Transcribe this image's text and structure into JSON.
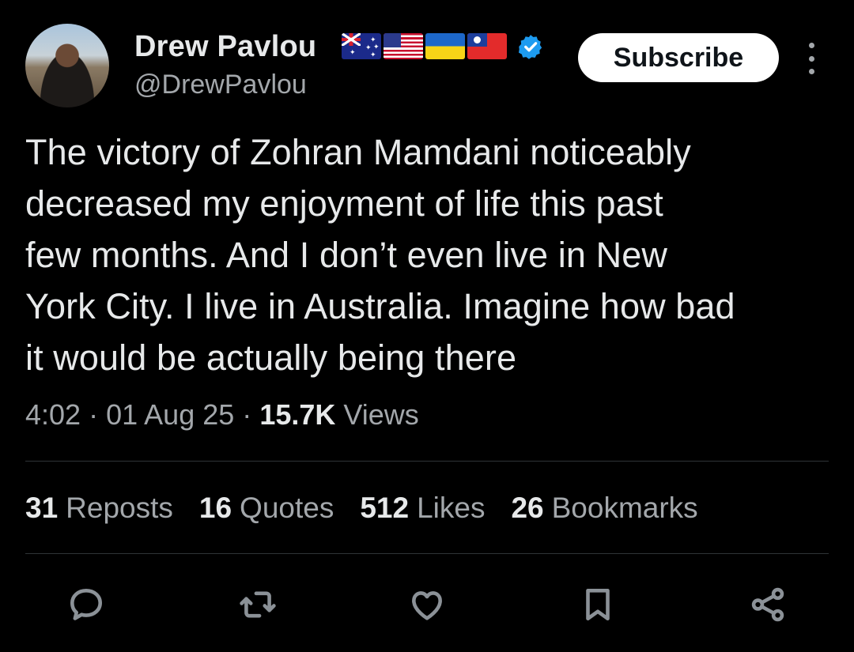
{
  "author": {
    "display_name": "Drew Pavlou",
    "handle": "@DrewPavlou",
    "flags": [
      "australia-flag-icon",
      "usa-flag-icon",
      "ukraine-flag-icon",
      "taiwan-flag-icon"
    ],
    "verified": true
  },
  "subscribe_label": "Subscribe",
  "tweet": {
    "text": "The victory of Zohran Mamdani noticeably\ndecreased my enjoyment of life this past\nfew months. And I don’t even live in New\nYork City. I live in Australia. Imagine how bad\nit would be actually being there"
  },
  "meta": {
    "time": "4:02",
    "date": "01 Aug 25",
    "separator": "·",
    "views_count": "15.7K",
    "views_label": "Views"
  },
  "stats": {
    "reposts": {
      "count": "31",
      "label": "Reposts"
    },
    "quotes": {
      "count": "16",
      "label": "Quotes"
    },
    "likes": {
      "count": "512",
      "label": "Likes"
    },
    "bookmarks": {
      "count": "26",
      "label": "Bookmarks"
    }
  },
  "actions": [
    "reply-icon",
    "repost-icon",
    "like-icon",
    "bookmark-icon",
    "share-icon"
  ],
  "colors": {
    "background": "#000000",
    "text_primary": "#e7e9ea",
    "text_secondary": "#a3a7ab",
    "verified_blue": "#1d9bf0",
    "divider": "#2f3336"
  }
}
